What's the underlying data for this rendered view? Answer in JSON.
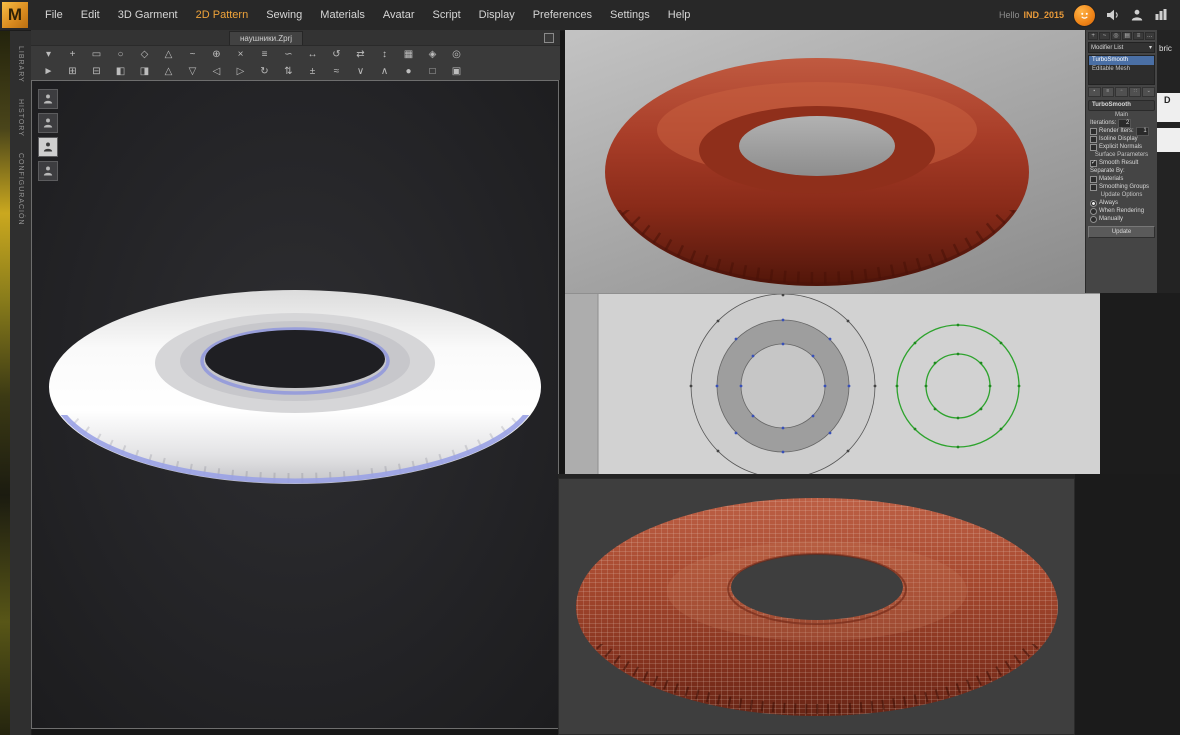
{
  "menubar": {
    "logo": "M",
    "items": [
      {
        "label": "File"
      },
      {
        "label": "Edit"
      },
      {
        "label": "3D Garment"
      },
      {
        "label": "2D Pattern",
        "active": true
      },
      {
        "label": "Sewing"
      },
      {
        "label": "Materials"
      },
      {
        "label": "Avatar"
      },
      {
        "label": "Script"
      },
      {
        "label": "Display"
      },
      {
        "label": "Preferences"
      },
      {
        "label": "Settings"
      },
      {
        "label": "Help"
      }
    ],
    "greeting": "Hello",
    "username": "IND_2015",
    "icons": [
      {
        "name": "chat-badge-icon"
      },
      {
        "name": "speaker-icon"
      },
      {
        "name": "user-icon"
      },
      {
        "name": "columns-icon"
      }
    ]
  },
  "sidebar": {
    "tabs": [
      {
        "label": "LIBRARY"
      },
      {
        "label": "HISTORY"
      },
      {
        "label": "CONFIGURACIÓN"
      }
    ]
  },
  "document_tab": {
    "title": "наушники.Zprj"
  },
  "toolbar": {
    "row1": [
      {
        "name": "dropdown-arrow-icon",
        "glyph": "▾"
      },
      {
        "name": "add-pattern-icon",
        "glyph": "+"
      },
      {
        "name": "rect-pattern-icon",
        "glyph": "▭"
      },
      {
        "name": "circle-pattern-icon",
        "glyph": "○"
      },
      {
        "name": "polygon-pattern-icon",
        "glyph": "◇"
      },
      {
        "name": "dart-tool-icon",
        "glyph": "△"
      },
      {
        "name": "curve-tool-icon",
        "glyph": "~"
      },
      {
        "name": "add-point-icon",
        "glyph": "⊕"
      },
      {
        "name": "cut-tool-icon",
        "glyph": "×"
      },
      {
        "name": "seam-tool-icon",
        "glyph": "≡"
      },
      {
        "name": "free-sew-icon",
        "glyph": "∽"
      },
      {
        "name": "measure-icon",
        "glyph": "↔"
      },
      {
        "name": "rotate-icon",
        "glyph": "↺"
      },
      {
        "name": "mirror-icon",
        "glyph": "⇄"
      },
      {
        "name": "grainline-icon",
        "glyph": "↕"
      },
      {
        "name": "grid-icon",
        "glyph": "▦"
      },
      {
        "name": "snap-icon",
        "glyph": "◈"
      },
      {
        "name": "target-icon",
        "glyph": "◎"
      }
    ],
    "row2": [
      {
        "name": "select-tool-icon",
        "glyph": "►"
      },
      {
        "name": "transform-icon",
        "glyph": "⊞"
      },
      {
        "name": "collapse-icon",
        "glyph": "⊟"
      },
      {
        "name": "half-left-icon",
        "glyph": "◧"
      },
      {
        "name": "half-right-icon",
        "glyph": "◨"
      },
      {
        "name": "tri-up-icon",
        "glyph": "△"
      },
      {
        "name": "tri-down-icon",
        "glyph": "▽"
      },
      {
        "name": "tri-left-icon",
        "glyph": "◁"
      },
      {
        "name": "tri-right-icon",
        "glyph": "▷"
      },
      {
        "name": "redo-icon",
        "glyph": "↻"
      },
      {
        "name": "swap-icon",
        "glyph": "⇅"
      },
      {
        "name": "offset-icon",
        "glyph": "±"
      },
      {
        "name": "wave-icon",
        "glyph": "≈"
      },
      {
        "name": "notch-down-icon",
        "glyph": "∨"
      },
      {
        "name": "notch-up-icon",
        "glyph": "∧"
      },
      {
        "name": "point-icon",
        "glyph": "●"
      },
      {
        "name": "square-icon",
        "glyph": "□"
      },
      {
        "name": "fill-square-icon",
        "glyph": "▣"
      }
    ]
  },
  "viewport_tools": [
    {
      "name": "avatar-show-button"
    },
    {
      "name": "avatar-pose-button"
    },
    {
      "name": "garment-show-button",
      "active": true
    },
    {
      "name": "avatar-bust-button"
    }
  ],
  "modifier_panel": {
    "tabs": [
      {
        "name": "create-tab-icon",
        "glyph": "+"
      },
      {
        "name": "modify-tab-icon",
        "glyph": "~"
      },
      {
        "name": "hierarchy-tab-icon",
        "glyph": "◎"
      },
      {
        "name": "motion-tab-icon",
        "glyph": "▤"
      },
      {
        "name": "display-tab-icon",
        "glyph": "≡"
      },
      {
        "name": "utilities-tab-icon",
        "glyph": "…"
      }
    ],
    "modifier_list_label": "Modifier List",
    "modifier_list_arrow": "▾",
    "stack_items": [
      "TurboSmooth",
      "Editable Mesh"
    ],
    "stack_buttons": [
      {
        "name": "pin-stack-icon",
        "glyph": "▪"
      },
      {
        "name": "show-end-result-icon",
        "glyph": "≡"
      },
      {
        "name": "make-unique-icon",
        "glyph": "▫"
      },
      {
        "name": "remove-modifier-icon",
        "glyph": "∷"
      },
      {
        "name": "configure-icon",
        "glyph": "⌄"
      }
    ],
    "rollout_turbosmooth": "TurboSmooth",
    "group_main": "Main",
    "iterations_label": "Iterations:",
    "iterations_value": "2",
    "render_iters_label": "Render Iters:",
    "render_iters_value": "1",
    "isoline_label": "Isoline Display",
    "explicit_label": "Explicit Normals",
    "surface_params_label": "Surface Parameters",
    "smooth_result_label": "Smooth Result",
    "separate_by_label": "Separate By:",
    "materials_label": "Materials",
    "smoothing_groups_label": "Smoothing Groups",
    "update_options_label": "Update Options",
    "always_label": "Always",
    "when_rendering_label": "When Rendering",
    "manually_label": "Manually",
    "update_button": "Update"
  },
  "right_edge": {
    "fabric_partial": "bric",
    "d_label": "D"
  },
  "colors": {
    "accent": "#efa33a",
    "torus_red": "#9c3a26",
    "torus_white": "#f2f2f2",
    "rim_blue": "#8f97dd",
    "pattern_green": "#2da32d"
  }
}
